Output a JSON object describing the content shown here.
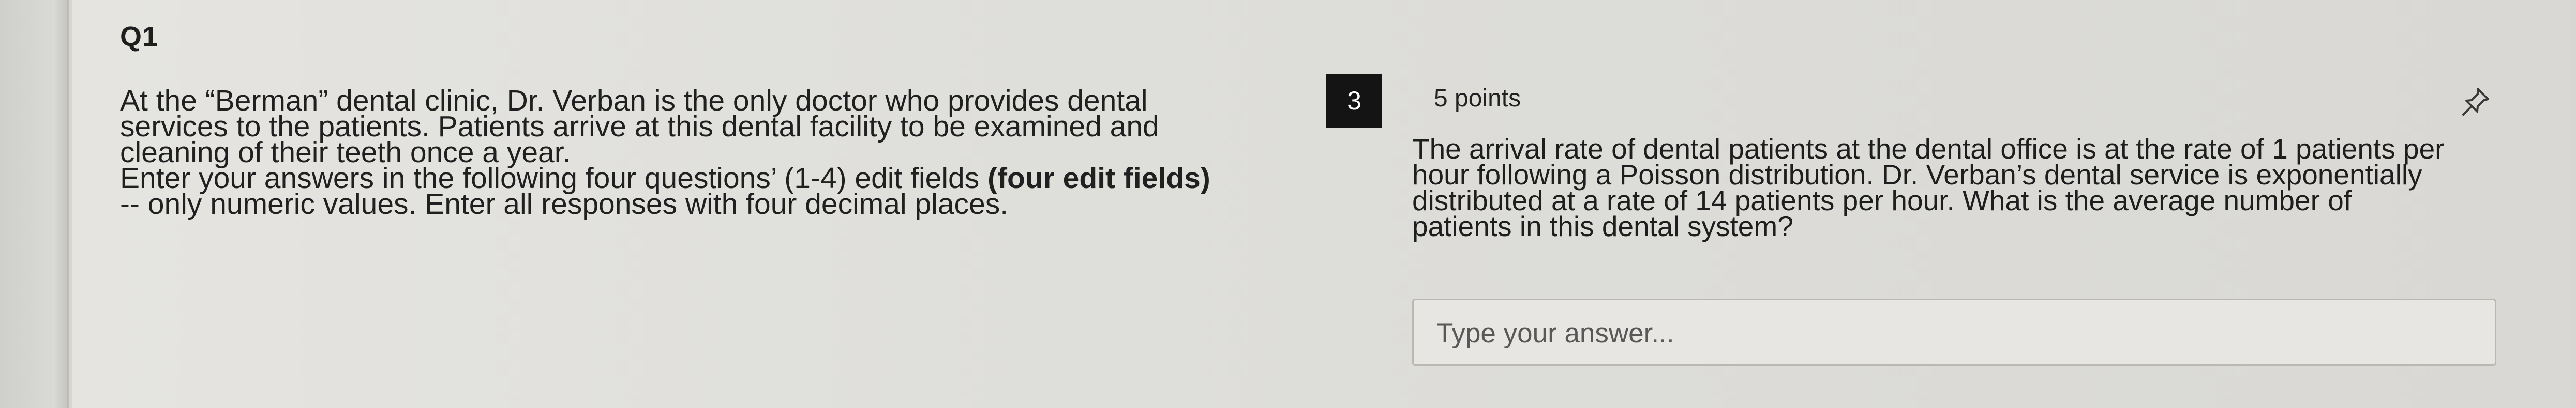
{
  "question_group": {
    "title": "Q1",
    "intro_lines": [
      "At the “Berman” dental clinic, Dr. Verban is the only doctor who provides dental",
      "services to the patients. Patients arrive at this dental facility to be examined and",
      "cleaning of their teeth once a year.",
      "Enter your answers in the following four questions’ (1-4) edit fields",
      "(four edit fields)",
      "-- only numeric values. Enter all responses with four decimal places."
    ]
  },
  "question": {
    "number": "3",
    "points": "5 points",
    "pin_icon": "pin-icon",
    "text_lines": [
      "The arrival rate of dental patients at the dental office is at the rate of 1 patients per",
      "hour following a Poisson distribution. Dr. Verban’s dental service is exponentially",
      "distributed at a rate of 14 patients per hour. What is the average number of",
      "patients in this dental system?"
    ],
    "answer": {
      "value": "",
      "placeholder": "Type your answer..."
    }
  },
  "colors": {
    "badge_bg": "#141414",
    "badge_text": "#ffffff",
    "panel_bg": "#e2e1dd",
    "input_border": "#b9b8b3"
  }
}
